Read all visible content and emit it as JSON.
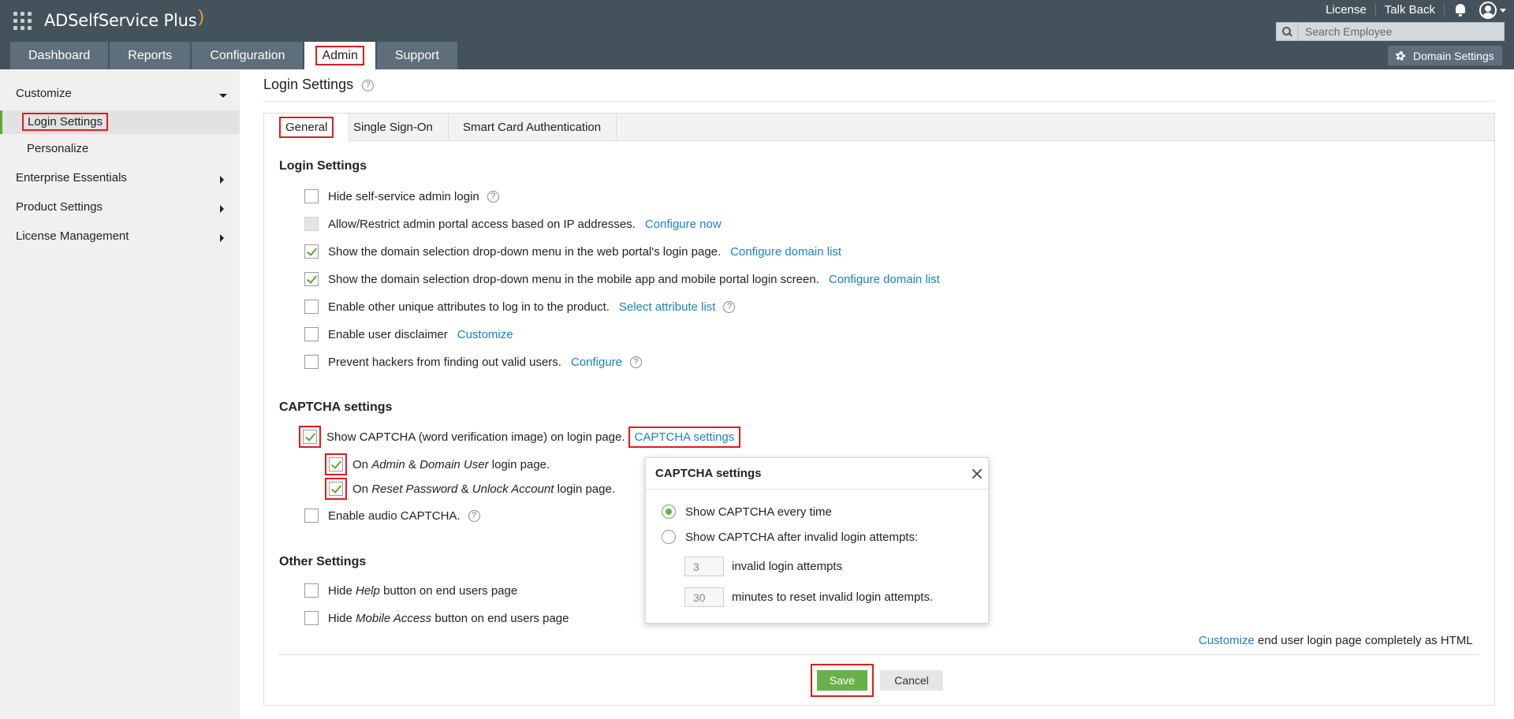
{
  "app": {
    "name": "ADSelfService Plus"
  },
  "top_links": {
    "license": "License",
    "talkback": "Talk Back"
  },
  "search": {
    "placeholder": "Search Employee"
  },
  "nav": {
    "tabs": [
      "Dashboard",
      "Reports",
      "Configuration",
      "Admin",
      "Support"
    ],
    "active": "Admin"
  },
  "domain_settings_label": "Domain Settings",
  "sidebar": {
    "customize": "Customize",
    "login_settings": "Login Settings",
    "personalize": "Personalize",
    "enterprise": "Enterprise Essentials",
    "product": "Product Settings",
    "license": "License Management"
  },
  "page": {
    "title": "Login Settings"
  },
  "tabs": [
    "General",
    "Single Sign-On",
    "Smart Card Authentication"
  ],
  "login_settings": {
    "heading": "Login Settings",
    "hide_admin": "Hide self-service admin login",
    "ip_restrict": "Allow/Restrict admin portal access based on IP addresses.",
    "ip_link": "Configure now",
    "domain_web": "Show the domain selection drop-down menu in the web portal's login page.",
    "domain_web_link": "Configure domain list",
    "domain_mobile": "Show the domain selection drop-down menu in the mobile app and mobile portal login screen.",
    "domain_mobile_link": "Configure domain list",
    "unique_attr": "Enable other unique attributes to log in to the product.",
    "unique_attr_link": "Select attribute list",
    "disclaimer": "Enable user disclaimer",
    "disclaimer_link": "Customize",
    "prevent": "Prevent hackers from finding out valid users.",
    "prevent_link": "Configure"
  },
  "captcha": {
    "heading": "CAPTCHA settings",
    "show": "Show CAPTCHA (word verification image) on login page.",
    "show_link": "CAPTCHA settings",
    "admin_on": "On",
    "admin_admin": "Admin",
    "amp": "&",
    "admin_domain": "Domain User",
    "admin_suffix": "login page.",
    "reset_reset": "Reset Password",
    "reset_unlock": "Unlock Account",
    "audio": "Enable audio CAPTCHA."
  },
  "other": {
    "heading": "Other Settings",
    "hide_prefix": "Hide",
    "help_word": "Help",
    "mobile_word": "Mobile Access",
    "button_suffix": "button on end users page"
  },
  "footer": {
    "customize_link": "Customize",
    "customize_text": "end user login page completely as HTML"
  },
  "buttons": {
    "save": "Save",
    "cancel": "Cancel"
  },
  "popup": {
    "title": "CAPTCHA settings",
    "opt_every": "Show CAPTCHA every time",
    "opt_after": "Show CAPTCHA after invalid login attempts:",
    "attempts_value": "3",
    "attempts_label": "invalid login attempts",
    "minutes_value": "30",
    "minutes_label": "minutes to reset invalid login attempts."
  },
  "colors": {
    "header": "#44525c",
    "accent_green": "#6ab04a",
    "link": "#1b7fc4",
    "highlight": "#e01b1b"
  }
}
